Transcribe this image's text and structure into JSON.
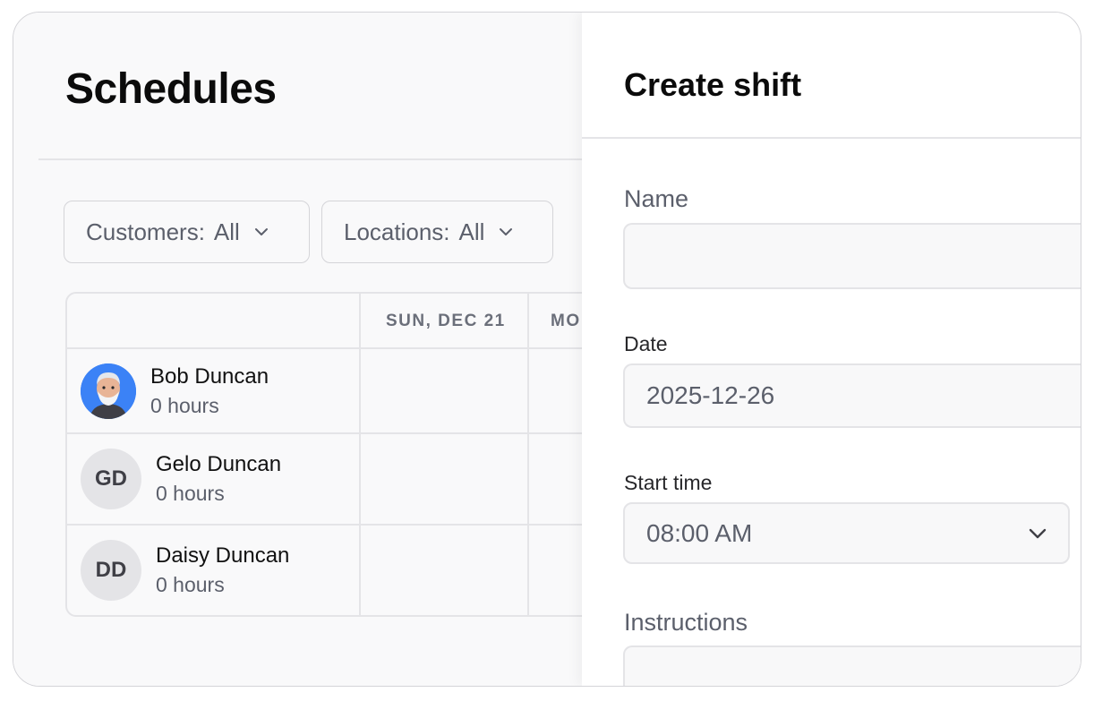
{
  "main": {
    "title": "Schedules",
    "filters": [
      {
        "label": "Customers:",
        "value": "All"
      },
      {
        "label": "Locations:",
        "value": "All"
      }
    ],
    "table": {
      "day_headers": [
        "SUN, DEC 21",
        "MO"
      ],
      "employees": [
        {
          "name": "Bob Duncan",
          "hours": "0 hours",
          "initials": "",
          "avatar": "photo"
        },
        {
          "name": "Gelo Duncan",
          "hours": "0 hours",
          "initials": "GD",
          "avatar": "initials"
        },
        {
          "name": "Daisy Duncan",
          "hours": "0 hours",
          "initials": "DD",
          "avatar": "initials"
        }
      ]
    }
  },
  "panel": {
    "title": "Create shift",
    "fields": {
      "name": {
        "label": "Name",
        "value": ""
      },
      "date": {
        "label": "Date",
        "value": "2025-12-26"
      },
      "start_time": {
        "label": "Start time",
        "value": "08:00 AM"
      },
      "instructions": {
        "label": "Instructions",
        "value": ""
      }
    }
  },
  "icons": {
    "filter_chevron": "chevron-down-icon",
    "select_chevron": "chevron-down-icon"
  },
  "colors": {
    "border": "#e4e4e7",
    "muted_text": "#5b5f6b",
    "avatar_bg": "#e4e4e7",
    "photo_bg": "#3b82f6"
  }
}
